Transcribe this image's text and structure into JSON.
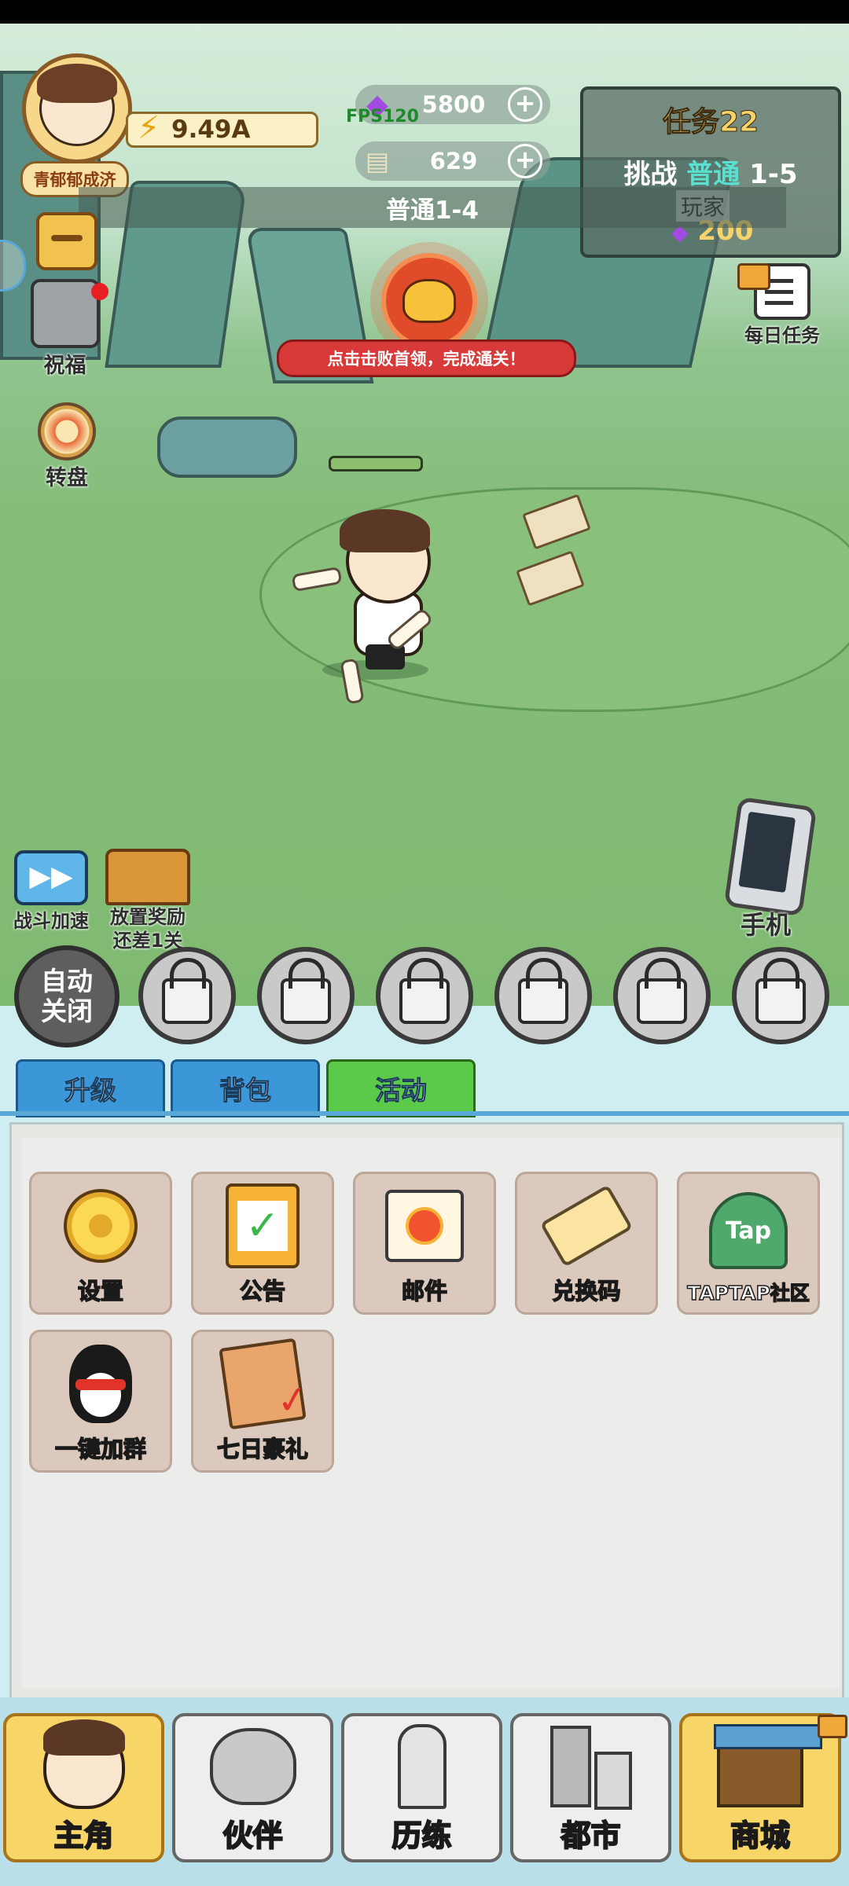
{
  "player": {
    "name": "青郁郁成济",
    "gold": "9.49A"
  },
  "resources": {
    "gems": "5800",
    "cash": "629",
    "fps": "FPS120"
  },
  "task": {
    "title": "任务22",
    "challenge_prefix": "挑战",
    "challenge_mode": "普通",
    "challenge_level": "1-5",
    "player_tag": "玩家",
    "reward": "200"
  },
  "stage": {
    "label": "普通1-4"
  },
  "side_left": {
    "blessing": "祝福",
    "wheel": "转盘"
  },
  "side_right": {
    "daily_task": "每日任务",
    "phone": "手机"
  },
  "boss": {
    "banner": "点击击败首领，完成通关！"
  },
  "speed": {
    "label": "战斗加速"
  },
  "idle_reward": {
    "line1": "放置奖励",
    "line2": "还差1关"
  },
  "auto": {
    "line1": "自动",
    "line2": "关闭"
  },
  "tabs": [
    {
      "label": "升级"
    },
    {
      "label": "背包"
    },
    {
      "label": "活动"
    }
  ],
  "activities": [
    {
      "label": "设置"
    },
    {
      "label": "公告"
    },
    {
      "label": "邮件"
    },
    {
      "label": "兑换码"
    },
    {
      "label": "TAPTAP社区"
    },
    {
      "label": "一键加群"
    },
    {
      "label": "七日豪礼"
    }
  ],
  "tap_logo": "Tap",
  "nav": [
    {
      "label": "主角"
    },
    {
      "label": "伙伴"
    },
    {
      "label": "历练"
    },
    {
      "label": "都市"
    },
    {
      "label": "商城"
    }
  ],
  "colors": {
    "accent_green": "#5bc94a",
    "tab_blue": "#3c97d8",
    "alert_red": "#d83a3a"
  }
}
